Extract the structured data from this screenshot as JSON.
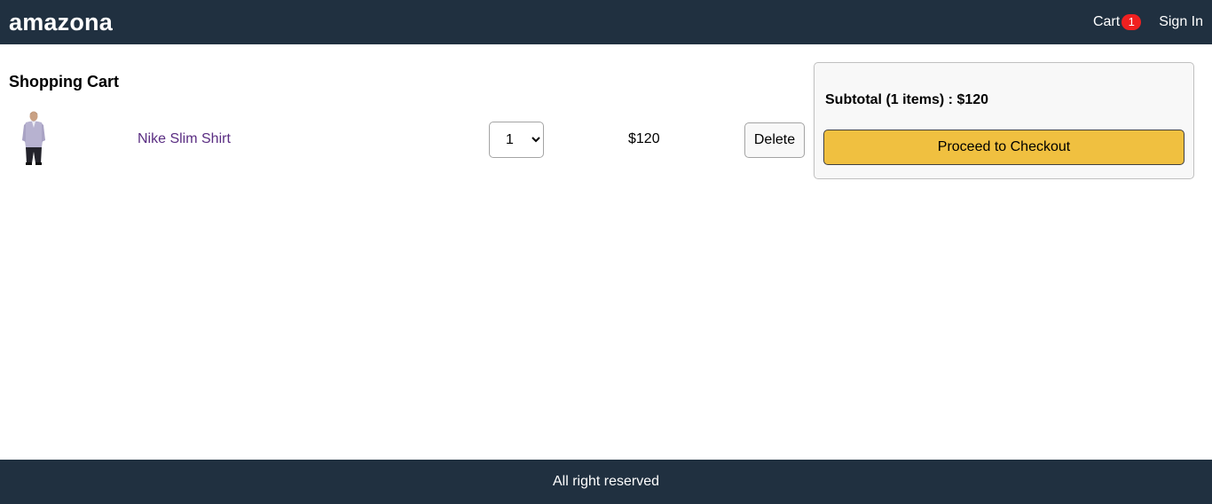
{
  "header": {
    "brand": "amazona",
    "cart_label": "Cart",
    "cart_count": "1",
    "signin_label": "Sign In"
  },
  "cart": {
    "title": "Shopping Cart",
    "items": [
      {
        "name": "Nike Slim Shirt",
        "quantity": "1",
        "price": "$120",
        "delete_label": "Delete",
        "image": "shirt-product-photo"
      }
    ]
  },
  "summary": {
    "subtotal_text": "Subtotal (1 items) : $120",
    "checkout_label": "Proceed to Checkout"
  },
  "footer": {
    "text": "All right reserved"
  },
  "colors": {
    "header_bg": "#203040",
    "badge": "#f02020",
    "checkout": "#f0c040",
    "link": "#5a2d82"
  }
}
